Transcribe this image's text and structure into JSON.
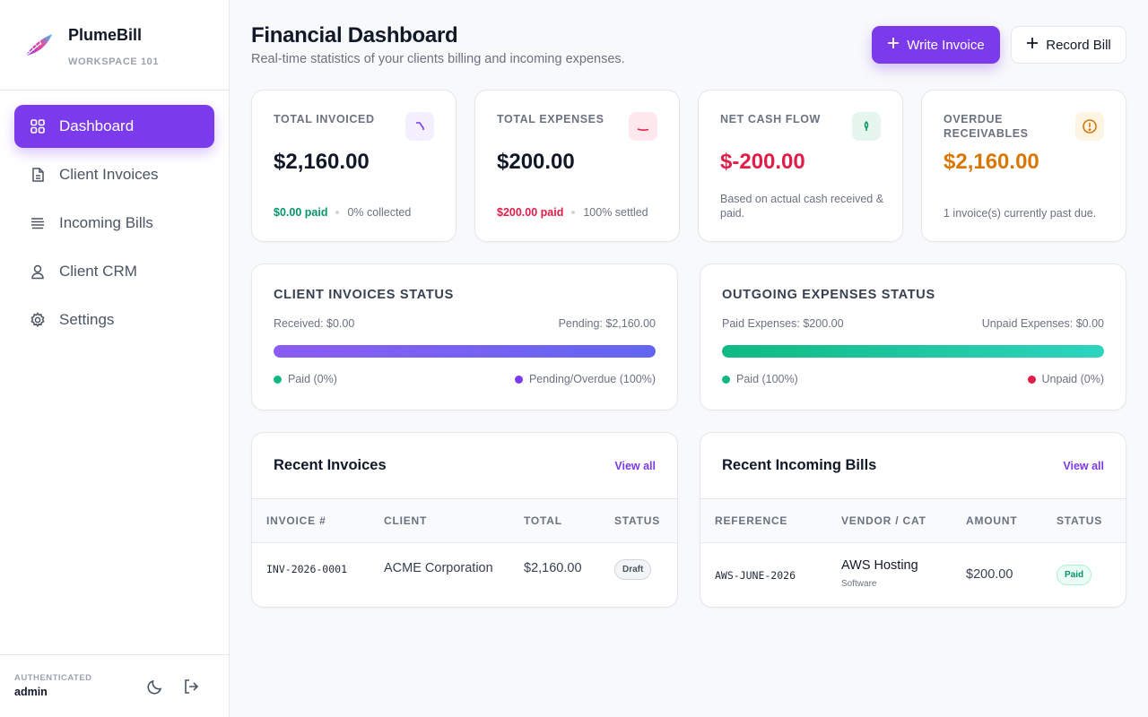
{
  "brand": {
    "name": "PlumeBill",
    "workspace": "WORKSPACE 101"
  },
  "nav": [
    {
      "label": "Dashboard",
      "icon": "grid-icon",
      "active": true
    },
    {
      "label": "Client Invoices",
      "icon": "document-icon"
    },
    {
      "label": "Incoming Bills",
      "icon": "stack-icon"
    },
    {
      "label": "Client CRM",
      "icon": "user-icon"
    },
    {
      "label": "Settings",
      "icon": "gear-icon"
    }
  ],
  "footer": {
    "auth_label": "AUTHENTICATED",
    "user": "admin"
  },
  "header": {
    "title": "Financial Dashboard",
    "subtitle": "Real-time statistics of your clients billing and incoming expenses.",
    "write_invoice": "Write Invoice",
    "record_bill": "Record Bill"
  },
  "stats": [
    {
      "label": "TOTAL INVOICED",
      "value": "$2,160.00",
      "foot_a": "$0.00 paid",
      "foot_b": "0% collected",
      "icon": "trend-down-icon",
      "accent": "#7c3aed"
    },
    {
      "label": "TOTAL EXPENSES",
      "value": "$200.00",
      "foot_a": "$200.00 paid",
      "foot_b": "100% settled",
      "icon": "arc-icon",
      "accent": "#e11d48"
    },
    {
      "label": "NET CASH FLOW",
      "value": "$-200.00",
      "note": "Based on actual cash received & paid.",
      "icon": "leaf-icon",
      "accent": "#e11d48"
    },
    {
      "label": "OVERDUE RECEIVABLES",
      "value": "$2,160.00",
      "note": "1 invoice(s) currently past due.",
      "icon": "alert-circle-icon",
      "accent": "#d97706"
    }
  ],
  "invoice_status": {
    "title": "CLIENT INVOICES STATUS",
    "left": "Received: $0.00",
    "right": "Pending: $2,160.00",
    "paid_fraction": 0,
    "legend_paid": "Paid (0%)",
    "legend_pending": "Pending/Overdue (100%)"
  },
  "expense_status": {
    "title": "OUTGOING EXPENSES STATUS",
    "left": "Paid Expenses: $200.00",
    "right": "Unpaid Expenses: $0.00",
    "paid_fraction": 1,
    "legend_paid": "Paid (100%)",
    "legend_unpaid": "Unpaid (0%)"
  },
  "recent_invoices": {
    "title": "Recent Invoices",
    "view_all": "View all",
    "columns": [
      "INVOICE #",
      "CLIENT",
      "TOTAL",
      "STATUS"
    ],
    "rows": [
      {
        "number": "INV-2026-0001",
        "client": "ACME Corporation",
        "total": "$2,160.00",
        "status": "Draft"
      }
    ]
  },
  "recent_bills": {
    "title": "Recent Incoming Bills",
    "view_all": "View all",
    "columns": [
      "REFERENCE",
      "VENDOR / CAT",
      "AMOUNT",
      "STATUS"
    ],
    "rows": [
      {
        "reference": "AWS-JUNE-2026",
        "vendor": "AWS Hosting",
        "category": "Software",
        "amount": "$200.00",
        "status": "Paid"
      }
    ]
  }
}
